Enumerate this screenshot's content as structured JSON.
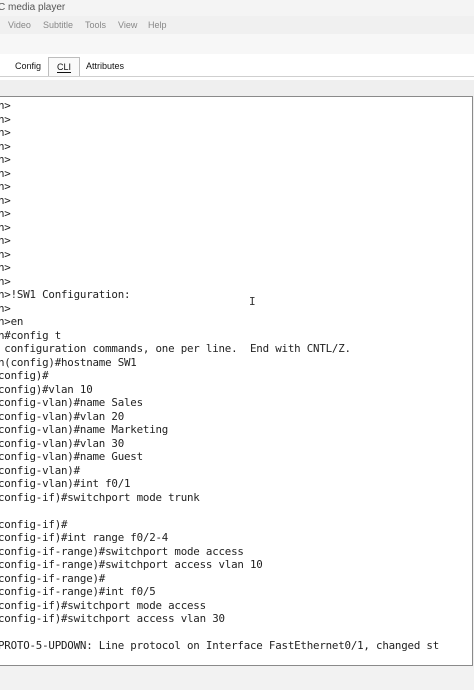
{
  "window": {
    "title": "C media player"
  },
  "menu": [
    "Video",
    "Subtitle",
    "Tools",
    "View",
    "Help"
  ],
  "tabs": [
    {
      "label": "Config",
      "active": false
    },
    {
      "label": "CLI",
      "active": true
    },
    {
      "label": "Attributes",
      "active": false
    }
  ],
  "cli": {
    "lines": [
      "h>",
      "h>",
      "h>",
      "h>",
      "h>",
      "h>",
      "h>",
      "h>",
      "h>",
      "h>",
      "h>",
      "h>",
      "h>",
      "h>",
      "h>!SW1 Configuration:",
      "h>",
      "h>en",
      "h#config t",
      " configuration commands, one per line.  End with CNTL/Z.",
      "h(config)#hostname SW1",
      "config)#",
      "config)#vlan 10",
      "config-vlan)#name Sales",
      "config-vlan)#vlan 20",
      "config-vlan)#name Marketing",
      "config-vlan)#vlan 30",
      "config-vlan)#name Guest",
      "config-vlan)#",
      "config-vlan)#int f0/1",
      "config-if)#switchport mode trunk",
      "",
      "config-if)#",
      "config-if)#int range f0/2-4",
      "config-if-range)#switchport mode access",
      "config-if-range)#switchport access vlan 10",
      "config-if-range)#",
      "config-if-range)#int f0/5",
      "config-if)#switchport mode access",
      "config-if)#switchport access vlan 30",
      "",
      "PROTO-5-UPDOWN: Line protocol on Interface FastEthernet0/1, changed st",
      "",
      "PROTO-5-UPDOWN: Line protocol on Interface FastEthernet0/1, changed st"
    ]
  }
}
